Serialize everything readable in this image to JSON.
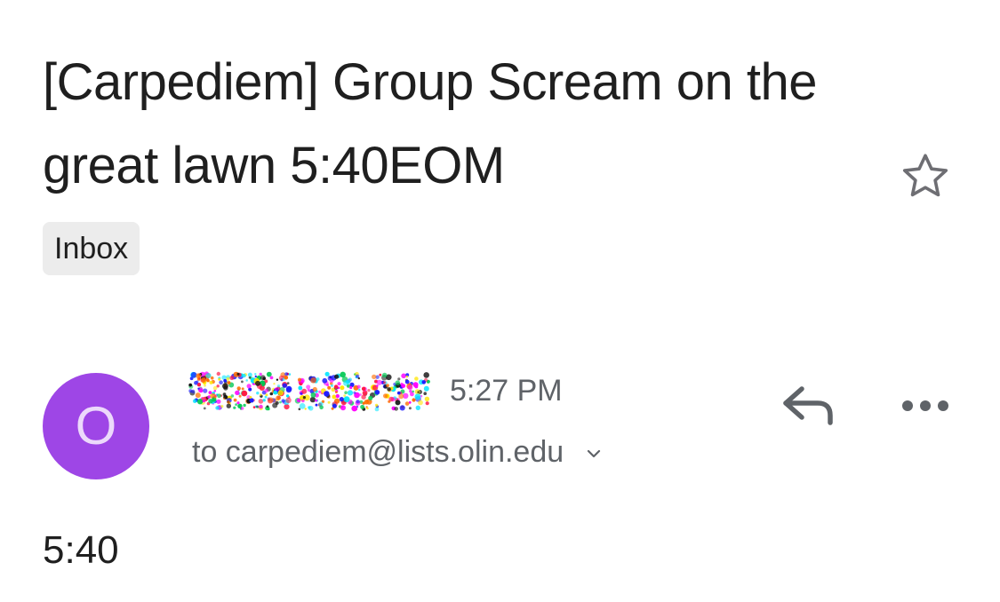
{
  "message": {
    "subject": "[Carpediem] Group Scream on the great lawn 5:40EOM",
    "label": "Inbox",
    "sender": {
      "avatar_letter": "O",
      "avatar_color": "#9e46e6",
      "name": "",
      "time": "5:27 PM"
    },
    "recipient_line": "to carpediem@lists.olin.edu",
    "body": "5:40"
  },
  "icons": {
    "star": "star-outline-icon",
    "reply": "reply-icon",
    "more": "more-horiz-icon",
    "recipients_expand": "chevron-down-icon"
  }
}
